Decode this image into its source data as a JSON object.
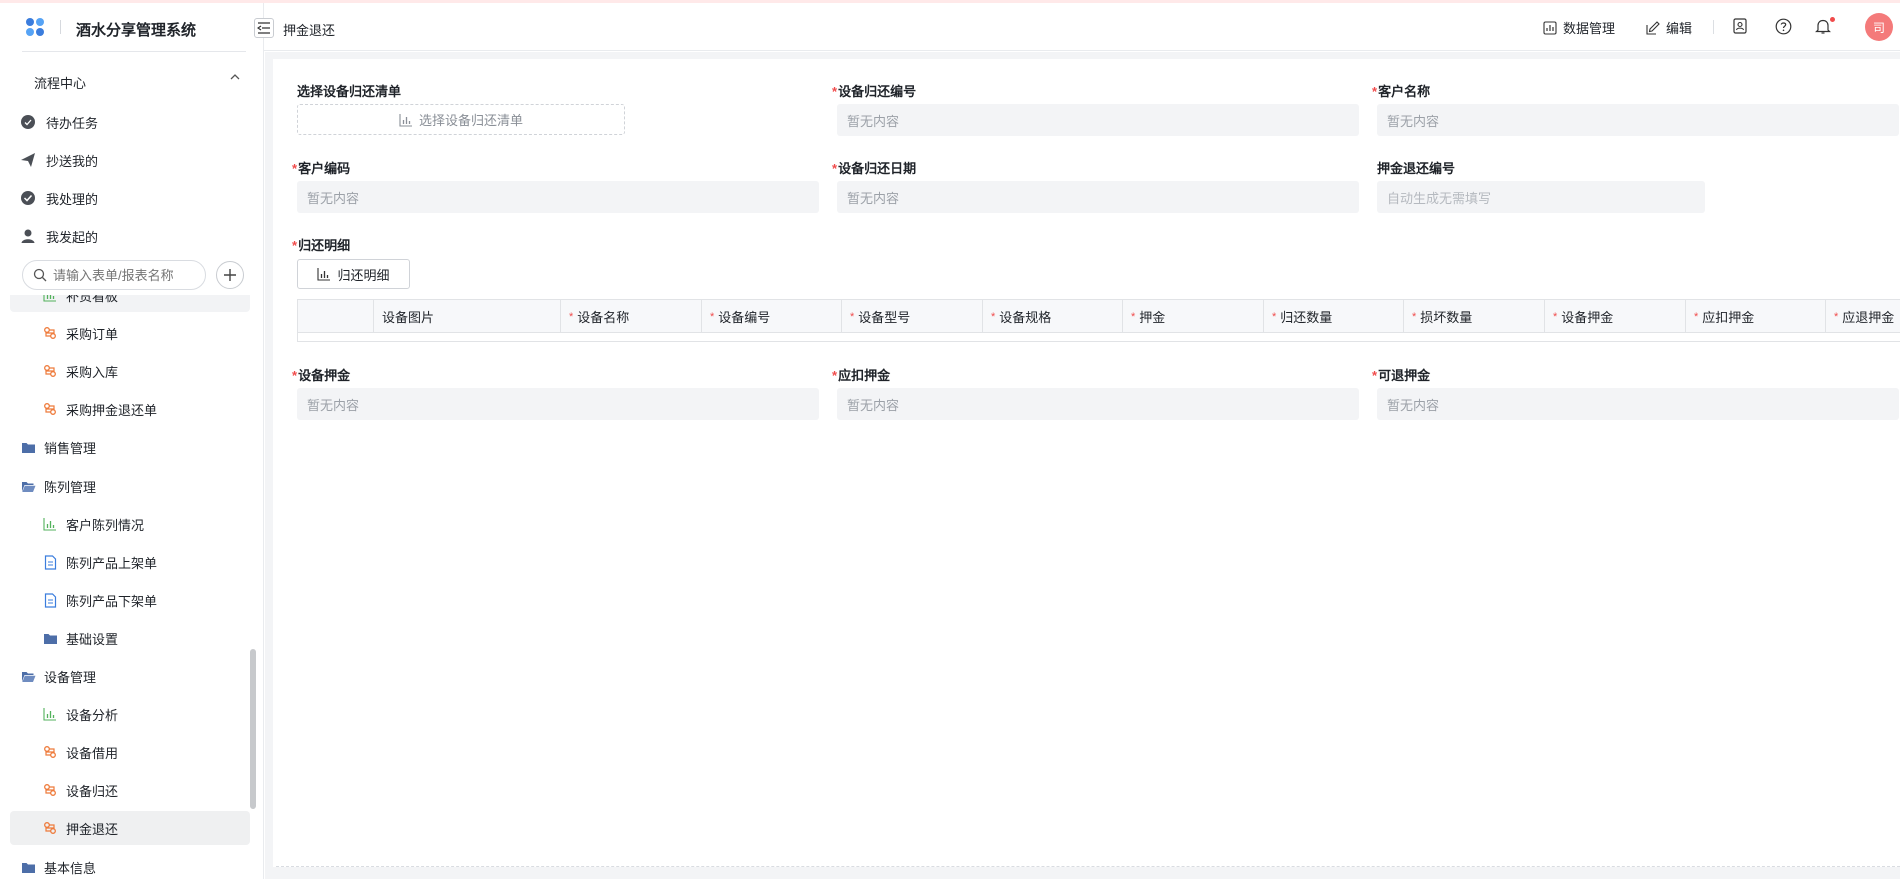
{
  "app": {
    "name": "酒水分享管理系统"
  },
  "header": {
    "page_title": "押金退还",
    "data_manage_label": "数据管理",
    "edit_label": "编辑",
    "avatar_text": "司"
  },
  "sidebar": {
    "flow_center": "流程中心",
    "flow_items": [
      {
        "label": "待办任务"
      },
      {
        "label": "抄送我的"
      },
      {
        "label": "我处理的"
      },
      {
        "label": "我发起的"
      }
    ],
    "search_placeholder": "请输入表单/报表名称",
    "menu": [
      {
        "label": "补货看板",
        "level": 2,
        "icon": "bar-chart-icon"
      },
      {
        "label": "采购订单",
        "level": 2,
        "icon": "flow-icon"
      },
      {
        "label": "采购入库",
        "level": 2,
        "icon": "flow-icon"
      },
      {
        "label": "采购押金退还单",
        "level": 2,
        "icon": "flow-icon"
      },
      {
        "label": "销售管理",
        "level": 1,
        "icon": "folder-icon"
      },
      {
        "label": "陈列管理",
        "level": 1,
        "icon": "folder-open-icon"
      },
      {
        "label": "客户陈列情况",
        "level": 2,
        "icon": "bar-chart-icon"
      },
      {
        "label": "陈列产品上架单",
        "level": 2,
        "icon": "form-icon"
      },
      {
        "label": "陈列产品下架单",
        "level": 2,
        "icon": "form-icon"
      },
      {
        "label": "基础设置",
        "level": 2,
        "icon": "folder-icon"
      },
      {
        "label": "设备管理",
        "level": 1,
        "icon": "folder-open-icon"
      },
      {
        "label": "设备分析",
        "level": 2,
        "icon": "bar-chart-icon"
      },
      {
        "label": "设备借用",
        "level": 2,
        "icon": "flow-icon"
      },
      {
        "label": "设备归还",
        "level": 2,
        "icon": "flow-icon"
      },
      {
        "label": "押金退还",
        "level": 2,
        "icon": "flow-icon",
        "active": true
      },
      {
        "label": "基本信息",
        "level": 1,
        "icon": "folder-icon"
      }
    ]
  },
  "form": {
    "select_return_list": {
      "label": "选择设备归还清单",
      "button": "选择设备归还清单"
    },
    "return_no": {
      "label": "设备归还编号",
      "value": "暂无内容"
    },
    "customer_name": {
      "label": "客户名称",
      "value": "暂无内容"
    },
    "customer_code": {
      "label": "客户编码",
      "value": "暂无内容"
    },
    "return_date": {
      "label": "设备归还日期",
      "value": "暂无内容"
    },
    "refund_no": {
      "label": "押金退还编号",
      "value": "自动生成无需填写"
    },
    "detail": {
      "label": "归还明细",
      "button": "归还明细"
    },
    "table_headers": [
      "设备图片",
      "设备名称",
      "设备编号",
      "设备型号",
      "设备规格",
      "押金",
      "归还数量",
      "损坏数量",
      "设备押金",
      "应扣押金",
      "应退押金"
    ],
    "device_deposit": {
      "label": "设备押金",
      "value": "暂无内容"
    },
    "deduct_deposit": {
      "label": "应扣押金",
      "value": "暂无内容"
    },
    "refundable_deposit": {
      "label": "可退押金",
      "value": "暂无内容"
    }
  },
  "colors": {
    "accent": "#f04b4b",
    "avatar": "#f47a7a",
    "flow_icon": "#ee7a3a",
    "chart_icon": "#53b25c",
    "folder_icon": "#4d6ea8",
    "form_icon": "#3b7ddd"
  }
}
